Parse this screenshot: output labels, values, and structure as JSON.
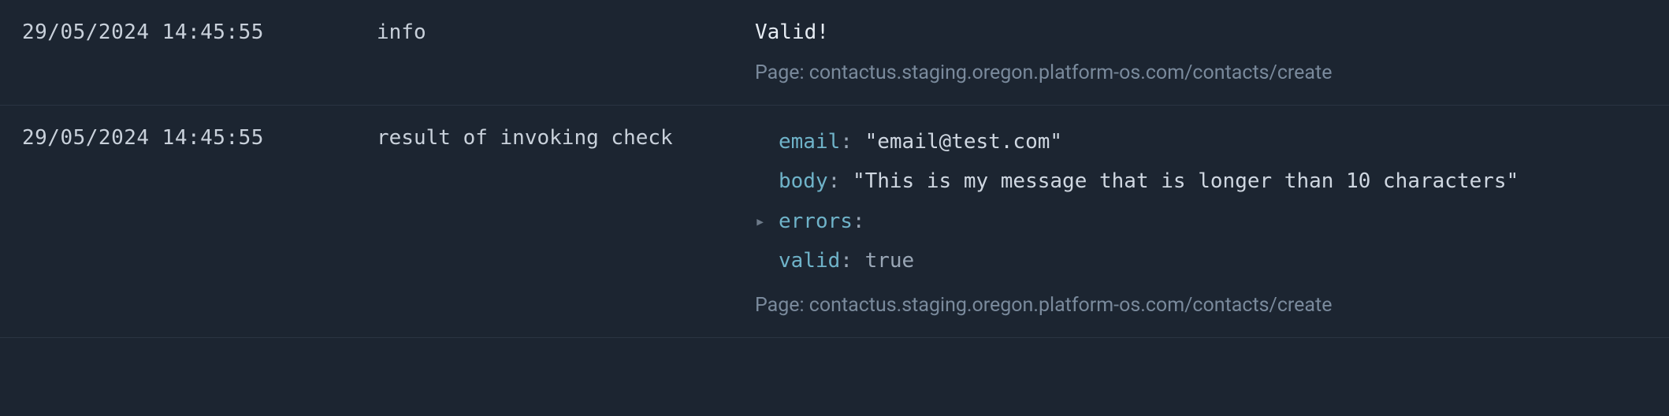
{
  "rows": [
    {
      "timestamp": "29/05/2024 14:45:55",
      "tag": "info",
      "message_title": "Valid!",
      "page_label": "Page:",
      "page_url": "contactus.staging.oregon.platform-os.com/contacts/create"
    },
    {
      "timestamp": "29/05/2024 14:45:55",
      "tag": "result of invoking check",
      "obj": {
        "email_key": "email",
        "email_val": "\"email@test.com\"",
        "body_key": "body",
        "body_val": "\"This is my message that is longer than 10 characters\"",
        "errors_key": "errors",
        "valid_key": "valid",
        "valid_val": "true"
      },
      "page_label": "Page:",
      "page_url": "contactus.staging.oregon.platform-os.com/contacts/create"
    }
  ]
}
